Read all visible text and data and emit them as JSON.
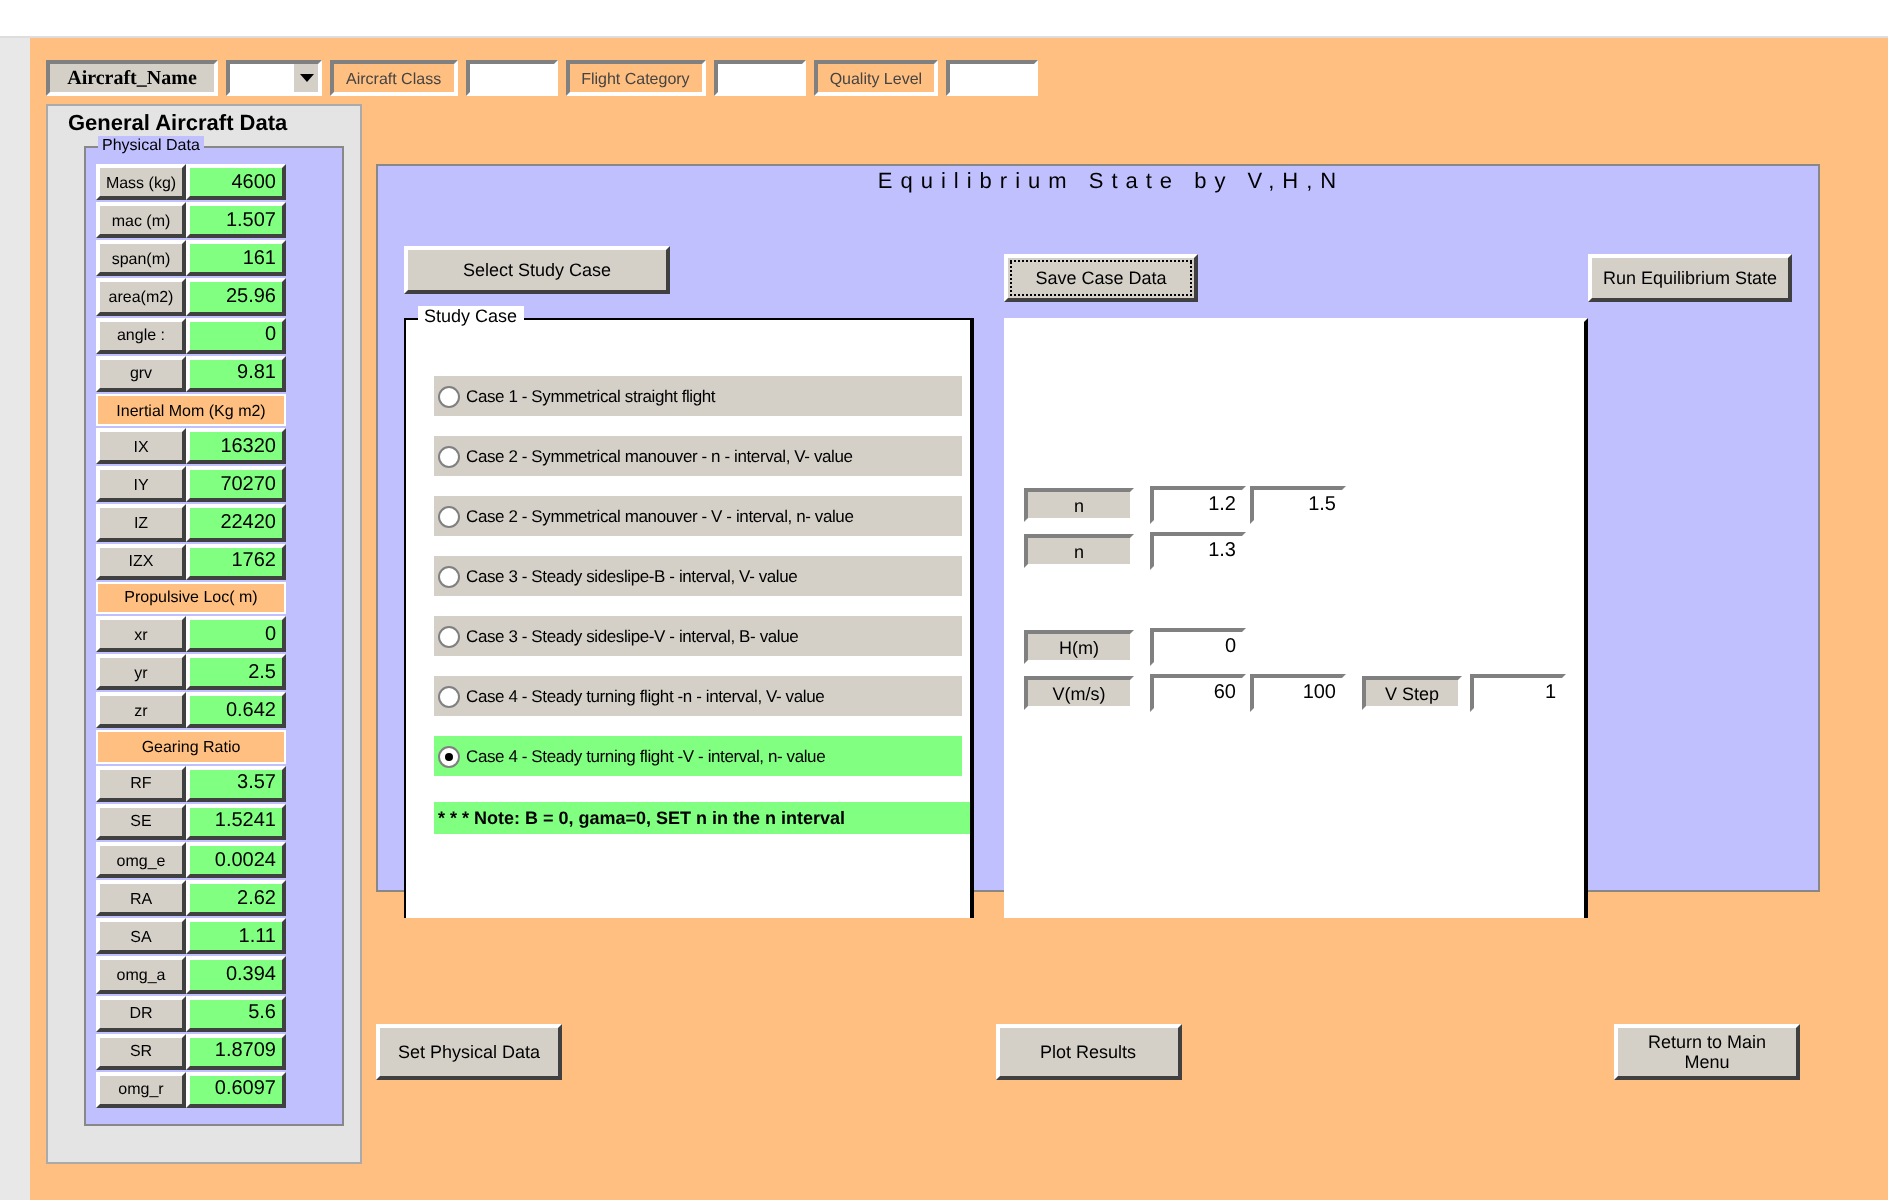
{
  "header": {
    "name_label": "Aircraft_Name",
    "class_label": "Aircraft Class",
    "category_label": "Flight Category",
    "quality_label": "Quality Level"
  },
  "general": {
    "title": "General Aircraft  Data",
    "physical": {
      "title": "Physical Data",
      "rows": [
        {
          "kind": "field",
          "label": "Mass (kg)",
          "value": "4600"
        },
        {
          "kind": "field",
          "label": "mac (m)",
          "value": "1.507"
        },
        {
          "kind": "field",
          "label": "span(m)",
          "value": "161"
        },
        {
          "kind": "field",
          "label": "area(m2)",
          "value": "25.96"
        },
        {
          "kind": "field",
          "label": "angle :",
          "value": "0"
        },
        {
          "kind": "field",
          "label": "grv",
          "value": "9.81"
        },
        {
          "kind": "section",
          "label": "Inertial Mom (Kg m2)"
        },
        {
          "kind": "field",
          "label": "IX",
          "value": "16320"
        },
        {
          "kind": "field",
          "label": "IY",
          "value": "70270"
        },
        {
          "kind": "field",
          "label": "IZ",
          "value": "22420"
        },
        {
          "kind": "field",
          "label": "IZX",
          "value": "1762"
        },
        {
          "kind": "section",
          "label": "Propulsive Loc( m)"
        },
        {
          "kind": "field",
          "label": "xr",
          "value": "0"
        },
        {
          "kind": "field",
          "label": "yr",
          "value": "2.5"
        },
        {
          "kind": "field",
          "label": "zr",
          "value": "0.642"
        },
        {
          "kind": "section",
          "label": "Gearing Ratio"
        },
        {
          "kind": "field",
          "label": "RF",
          "value": "3.57"
        },
        {
          "kind": "field",
          "label": "SE",
          "value": "1.5241"
        },
        {
          "kind": "field",
          "label": "omg_e",
          "value": "0.0024"
        },
        {
          "kind": "field",
          "label": "RA",
          "value": "2.62"
        },
        {
          "kind": "field",
          "label": "SA",
          "value": "1.11"
        },
        {
          "kind": "field",
          "label": "omg_a",
          "value": "0.394"
        },
        {
          "kind": "field",
          "label": "DR",
          "value": "5.6"
        },
        {
          "kind": "field",
          "label": "SR",
          "value": "1.8709"
        },
        {
          "kind": "field",
          "label": "omg_r",
          "value": "0.6097"
        }
      ]
    }
  },
  "main": {
    "title": "Equilibrium State by V,H,N",
    "buttons": [
      {
        "label": "Select Study Case",
        "focused": false
      },
      {
        "label": "Save Case Data",
        "focused": true
      },
      {
        "label": "Run Equilibrium State",
        "focused": false
      }
    ],
    "study_case": {
      "title": "Study Case",
      "options": [
        {
          "label": "Case 1 - Symmetrical straight flight",
          "selected": false
        },
        {
          "label": "Case 2 - Symmetrical manouver - n - interval, V- value",
          "selected": false
        },
        {
          "label": "Case 2 - Symmetrical manouver - V - interval, n- value",
          "selected": false
        },
        {
          "label": "Case 3 - Steady sideslipe-B - interval, V- value",
          "selected": false
        },
        {
          "label": "Case 3 - Steady sideslipe-V - interval, B- value",
          "selected": false
        },
        {
          "label": "Case 4 - Steady turning flight -n - interval, V- value",
          "selected": false
        },
        {
          "label": "Case 4 - Steady turning flight -V - interval, n- value",
          "selected": true
        }
      ],
      "note": "* * * Note: B = 0, gama=0, SET n in the n interval"
    },
    "params": [
      {
        "label": "n",
        "values": [
          "1.2",
          "1.5"
        ]
      },
      {
        "label": "n",
        "values": [
          "1.3"
        ]
      },
      {
        "label": "H(m)",
        "values": [
          "0"
        ]
      },
      {
        "label": "V(m/s)",
        "values": [
          "60",
          "100"
        ],
        "extra_label": "V Step",
        "extra_value": "1"
      }
    ]
  },
  "bottom_buttons": [
    "Set Physical Data",
    "Plot Results",
    "Return to Main Menu"
  ]
}
